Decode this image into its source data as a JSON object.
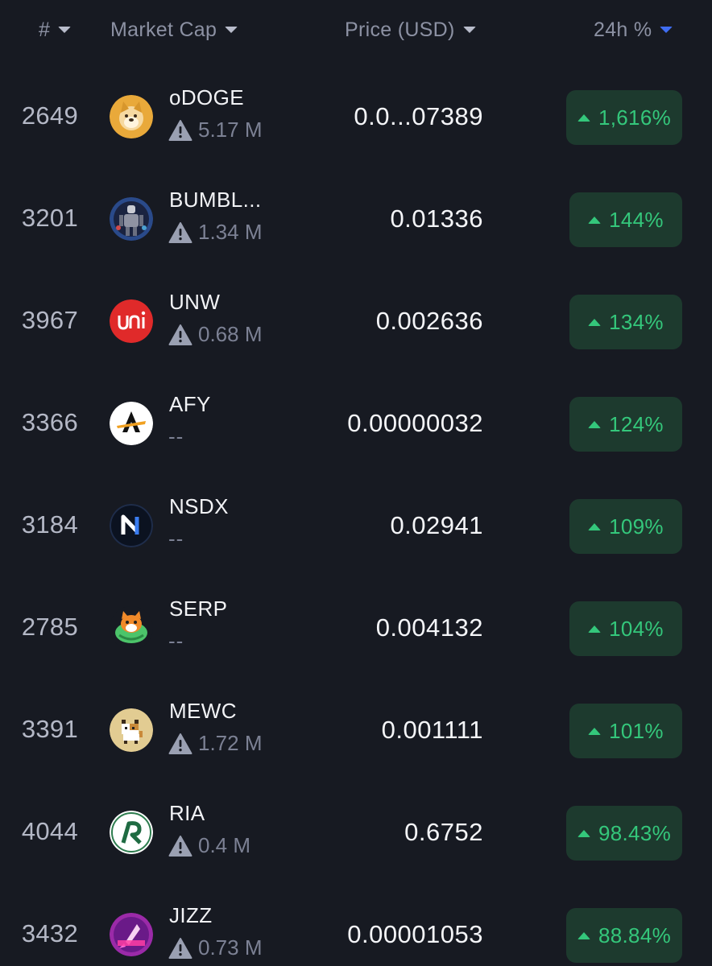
{
  "header": {
    "rank_label": "#",
    "market_cap_label": "Market Cap",
    "price_label": "Price (USD)",
    "change_label": "24h %"
  },
  "colors": {
    "background": "#171a22",
    "positive_text": "#34c77b",
    "positive_badge": "#1d3a2e",
    "active_sort": "#3f6df2"
  },
  "rows": [
    {
      "rank": "2649",
      "symbol": "oDOGE",
      "market_cap": "5.17 M",
      "warning": true,
      "price": "0.0...07389",
      "change": "1,616%",
      "icon": "dogecoin-shiba-logo-icon"
    },
    {
      "rank": "3201",
      "symbol": "BUMBL...",
      "market_cap": "1.34 M",
      "warning": true,
      "price": "0.01336",
      "change": "144%",
      "icon": "robot-figure-logo-icon"
    },
    {
      "rank": "3967",
      "symbol": "UNW",
      "market_cap": "0.68 M",
      "warning": true,
      "price": "0.002636",
      "change": "134%",
      "icon": "uni-red-logo-icon"
    },
    {
      "rank": "3366",
      "symbol": "AFY",
      "market_cap": "--",
      "warning": false,
      "price": "0.00000032",
      "change": "124%",
      "icon": "afy-a-logo-icon"
    },
    {
      "rank": "3184",
      "symbol": "NSDX",
      "market_cap": "--",
      "warning": false,
      "price": "0.02941",
      "change": "109%",
      "icon": "nsdx-n-logo-icon"
    },
    {
      "rank": "2785",
      "symbol": "SERP",
      "market_cap": "--",
      "warning": false,
      "price": "0.004132",
      "change": "104%",
      "icon": "serp-fox-frog-logo-icon"
    },
    {
      "rank": "3391",
      "symbol": "MEWC",
      "market_cap": "1.72 M",
      "warning": true,
      "price": "0.001111",
      "change": "101%",
      "icon": "pixel-cat-logo-icon"
    },
    {
      "rank": "4044",
      "symbol": "RIA",
      "market_cap": "0.4 M",
      "warning": true,
      "price": "0.6752",
      "change": "98.43%",
      "icon": "ria-r-logo-icon"
    },
    {
      "rank": "3432",
      "symbol": "JIZZ",
      "market_cap": "0.73 M",
      "warning": true,
      "price": "0.00001053",
      "change": "88.84%",
      "icon": "jizz-rocket-logo-icon"
    }
  ]
}
